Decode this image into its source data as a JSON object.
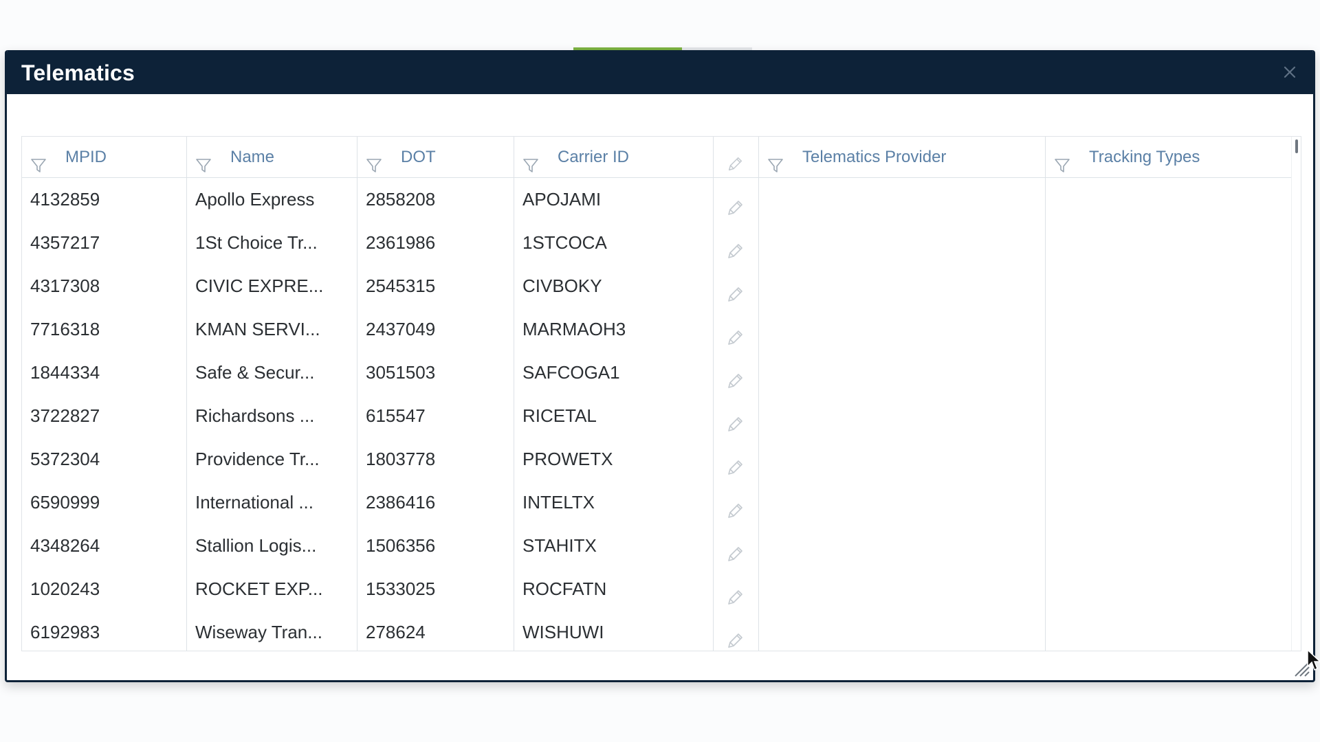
{
  "dialog": {
    "title": "Telematics"
  },
  "grid": {
    "columns": [
      {
        "key": "mpid",
        "label": "MPID",
        "filterable": true
      },
      {
        "key": "name",
        "label": "Name",
        "filterable": true
      },
      {
        "key": "dot",
        "label": "DOT",
        "filterable": true
      },
      {
        "key": "carrier_id",
        "label": "Carrier ID",
        "filterable": true
      },
      {
        "key": "edit",
        "label": "",
        "filterable": false
      },
      {
        "key": "telematics_provider",
        "label": "Telematics Provider",
        "filterable": true
      },
      {
        "key": "tracking_types",
        "label": "Tracking Types",
        "filterable": true
      }
    ],
    "rows": [
      {
        "mpid": "4132859",
        "name": "Apollo Express",
        "dot": "2858208",
        "carrier_id": "APOJAMI",
        "telematics_provider": "",
        "tracking_types": ""
      },
      {
        "mpid": "4357217",
        "name": "1St Choice Tr...",
        "dot": "2361986",
        "carrier_id": "1STCOCA",
        "telematics_provider": "",
        "tracking_types": ""
      },
      {
        "mpid": "4317308",
        "name": "CIVIC EXPRE...",
        "dot": "2545315",
        "carrier_id": "CIVBOKY",
        "telematics_provider": "",
        "tracking_types": ""
      },
      {
        "mpid": "7716318",
        "name": "KMAN SERVI...",
        "dot": "2437049",
        "carrier_id": "MARMAOH3",
        "telematics_provider": "",
        "tracking_types": ""
      },
      {
        "mpid": "1844334",
        "name": "Safe & Secur...",
        "dot": "3051503",
        "carrier_id": "SAFCOGA1",
        "telematics_provider": "",
        "tracking_types": ""
      },
      {
        "mpid": "3722827",
        "name": "Richardsons ...",
        "dot": "615547",
        "carrier_id": "RICETAL",
        "telematics_provider": "",
        "tracking_types": ""
      },
      {
        "mpid": "5372304",
        "name": "Providence Tr...",
        "dot": "1803778",
        "carrier_id": "PROWETX",
        "telematics_provider": "",
        "tracking_types": ""
      },
      {
        "mpid": "6590999",
        "name": "International ...",
        "dot": "2386416",
        "carrier_id": "INTELTX",
        "telematics_provider": "",
        "tracking_types": ""
      },
      {
        "mpid": "4348264",
        "name": "Stallion Logis...",
        "dot": "1506356",
        "carrier_id": "STAHITX",
        "telematics_provider": "",
        "tracking_types": ""
      },
      {
        "mpid": "1020243",
        "name": "ROCKET EXP...",
        "dot": "1533025",
        "carrier_id": "ROCFATN",
        "telematics_provider": "",
        "tracking_types": ""
      },
      {
        "mpid": "6192983",
        "name": "Wiseway Tran...",
        "dot": "278624",
        "carrier_id": "WISHUWI",
        "telematics_provider": "",
        "tracking_types": ""
      }
    ]
  },
  "icons": {
    "filter": "filter-funnel-icon",
    "edit": "pencil-icon",
    "close": "close-icon",
    "resize": "resize-grip-icon"
  },
  "colors": {
    "titlebar": "#0d2238",
    "header_text": "#5b80a6",
    "cell_text": "#2b2f33",
    "grid_line": "#dde2e7",
    "icon_grey": "#b9c0c7"
  }
}
